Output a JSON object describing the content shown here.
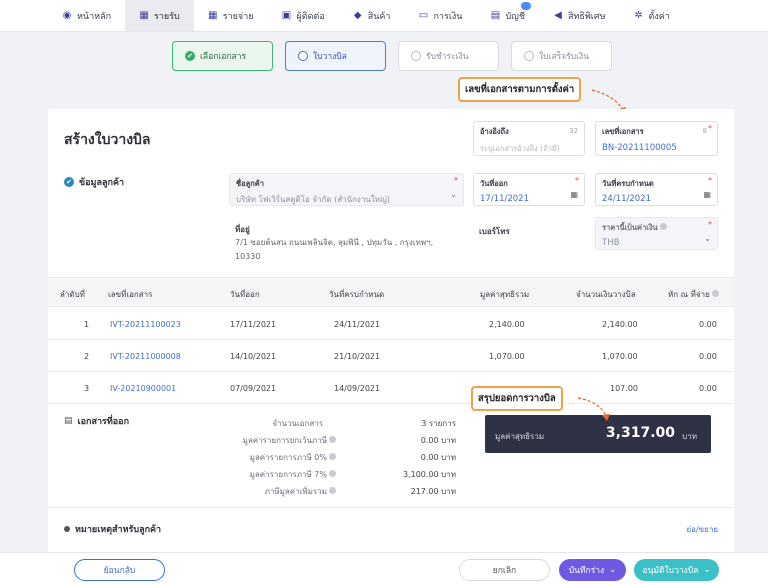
{
  "nav": {
    "items": [
      {
        "label": "หน้าหลัก",
        "icon": "palette-icon",
        "glyph": "◉"
      },
      {
        "label": "รายรับ",
        "icon": "chart-icon",
        "glyph": "▦",
        "active": true
      },
      {
        "label": "รายจ่าย",
        "icon": "chart-icon",
        "glyph": "▦"
      },
      {
        "label": "ผู้ติดต่อ",
        "icon": "contacts-icon",
        "glyph": "▣"
      },
      {
        "label": "สินค้า",
        "icon": "box-icon",
        "glyph": "◆"
      },
      {
        "label": "การเงิน",
        "icon": "money-icon",
        "glyph": "▭"
      },
      {
        "label": "บัญชี",
        "icon": "ledger-icon",
        "glyph": "▤"
      },
      {
        "label": "สิทธิพิเศษ",
        "icon": "megaphone-icon",
        "glyph": "◀"
      },
      {
        "label": "ตั้งค่า",
        "icon": "gear-icon",
        "glyph": "✲"
      }
    ]
  },
  "steps": [
    {
      "label": "เลือกเอกสาร",
      "state": "done"
    },
    {
      "label": "ใบวางบิล",
      "state": "current"
    },
    {
      "label": "รับชำระเงิน",
      "state": "todo"
    },
    {
      "label": "ใบเสร็จรับเงิน",
      "state": "todo"
    }
  ],
  "callouts": {
    "doc_number": "เลขที่เอกสารตามการตั้งค่า",
    "summary": "สรุปยอดการวางบิล"
  },
  "page_title": "สร้างใบวางบิล",
  "reference": {
    "label": "อ้างอิงถึง",
    "placeholder": "ระบุเอกสารอ้างอิง (ถ้ามี)",
    "counter": "32"
  },
  "doc_number": {
    "label": "เลขที่เอกสาร",
    "value": "BN-20211100005",
    "counter": "8"
  },
  "customer_section": "ข้อมูลลูกค้า",
  "customer": {
    "label": "ชื่อลูกค้า",
    "value": "บริษัท โฟเวิร์นสตูดิโอ จำกัด (สำนักงานใหญ่)"
  },
  "issue_date": {
    "label": "วันที่ออก",
    "value": "17/11/2021"
  },
  "due_date": {
    "label": "วันที่ครบกำหนด",
    "value": "24/11/2021"
  },
  "address": {
    "label": "ที่อยู่",
    "line1": "7/1 ซอยต้นสน ถนนเพลินจิต, ลุมพินี , ปทุมวัน , กรุงเทพฯ,",
    "line2": "10330"
  },
  "phone": {
    "label": "เบอร์โทร"
  },
  "price_type": {
    "label": "ราคานี้เป็นค่าเงิน",
    "value": "THB"
  },
  "table": {
    "headers": [
      "ลำดับที่",
      "เลขที่เอกสาร",
      "วันที่ออก",
      "วันที่ครบกำหนด",
      "มูลค่าสุทธิรวม",
      "จำนวนเงินวางบิล",
      "หัก ณ ที่จ่าย"
    ],
    "rows": [
      {
        "no": "1",
        "doc": "IVT-20211100023",
        "issue": "17/11/2021",
        "due": "24/11/2021",
        "net": "2,140.00",
        "bill": "2,140.00",
        "wht": "0.00"
      },
      {
        "no": "2",
        "doc": "IVT-20211000008",
        "issue": "14/10/2021",
        "due": "21/10/2021",
        "net": "1,070.00",
        "bill": "1,070.00",
        "wht": "0.00"
      },
      {
        "no": "3",
        "doc": "IV-20210900001",
        "issue": "07/09/2021",
        "due": "14/09/2021",
        "net": "",
        "bill": "107.00",
        "wht": "0.00"
      }
    ]
  },
  "issued_docs": "เอกสารที่ออก",
  "summary": [
    {
      "label": "จำนวนเอกสาร",
      "value": "3 รายการ",
      "help": false
    },
    {
      "label": "มูลค่ารายการยกเว้นภาษี",
      "value": "0.00 บาท",
      "help": true
    },
    {
      "label": "มูลค่ารายการภาษี 0%",
      "value": "0.00 บาท",
      "help": true
    },
    {
      "label": "มูลค่ารายการภาษี 7%",
      "value": "3,100.00 บาท",
      "help": true
    },
    {
      "label": "ภาษีมูลค่าเพิ่มรวม",
      "value": "217.00 บาท",
      "help": true
    }
  ],
  "total": {
    "label": "มูลค่าสุทธิรวม",
    "value": "3,317.00",
    "unit": "บาท"
  },
  "remarks": {
    "label": "หมายเหตุสำหรับลูกค้า",
    "toggle": "ย่อ/ขยาย"
  },
  "buttons": {
    "back": "ย้อนกลับ",
    "cancel": "ยกเลิก",
    "save_draft": "บันทึกร่าง",
    "approve": "อนุมัติใบวางบิล"
  },
  "colors": {
    "accent": "#3b6fd0",
    "callout_border": "#f0a14b",
    "total_bg": "#2f3245",
    "approve": "#3cc0c7",
    "draft": "#6d5ae0"
  }
}
